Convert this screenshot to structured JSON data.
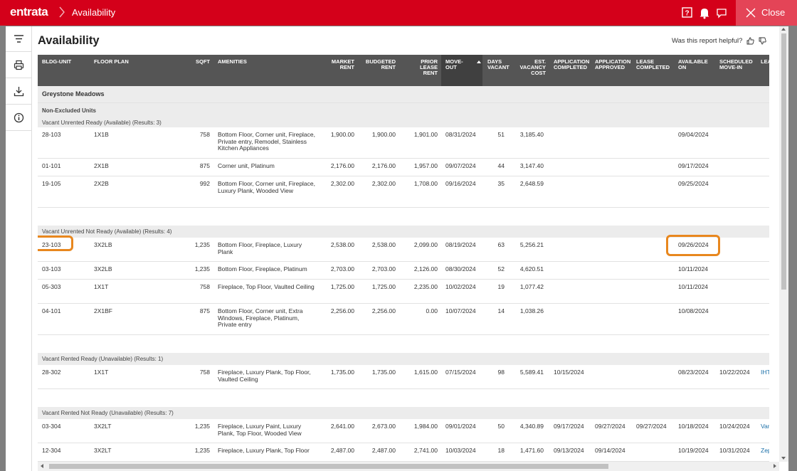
{
  "topbar": {
    "logo": "entrata",
    "breadcrumb": "Availability",
    "close_label": "Close",
    "color": "#d4001a"
  },
  "sidebar": {
    "icons": [
      "filter-icon",
      "print-icon",
      "download-icon",
      "info-icon"
    ]
  },
  "report": {
    "title": "Availability",
    "helpful_prompt": "Was this report helpful?"
  },
  "columns": {
    "bldg_unit": "BLDG-UNIT",
    "floor_plan": "FLOOR PLAN",
    "sqft": "SQFT",
    "amenities": "AMENITIES",
    "market_rent_1": "MARKET",
    "market_rent_2": "RENT",
    "budgeted_rent_1": "BUDGETED",
    "budgeted_rent_2": "RENT",
    "prior_lease_1": "PRIOR",
    "prior_lease_2": "LEASE",
    "prior_lease_3": "RENT",
    "move_out_1": "MOVE-",
    "move_out_2": "OUT",
    "days_vacant_1": "DAYS",
    "days_vacant_2": "VACANT",
    "vacancy_cost_1": "EST.",
    "vacancy_cost_2": "VACANCY",
    "vacancy_cost_3": "COST",
    "app_completed_1": "APPLICATION",
    "app_completed_2": "COMPLETED",
    "app_approved_1": "APPLICATION",
    "app_approved_2": "APPROVED",
    "lease_completed_1": "LEASE",
    "lease_completed_2": "COMPLETED",
    "available_on_1": "AVAILABLE",
    "available_on_2": "ON",
    "scheduled_1": "SCHEDULED",
    "scheduled_2": "MOVE-IN",
    "lead": "LEA"
  },
  "property": "Greystone Meadows",
  "non_excluded": "Non-Excluded Units",
  "groups": {
    "g1": "Vacant Unrented Ready (Available) (Results: 3)",
    "g2": "Vacant Unrented Not Ready (Available) (Results: 4)",
    "g3": "Vacant Rented Ready (Unavailable) (Results: 1)",
    "g4": "Vacant Rented Not Ready (Unavailable) (Results: 7)"
  },
  "rows": [
    {
      "unit": "28-103",
      "plan": "1X1B",
      "sqft": "758",
      "amenities": "Bottom Floor, Corner unit, Fireplace, Private entry, Remodel, Stainless Kitchen Appliances",
      "market": "1,900.00",
      "budgeted": "1,900.00",
      "prior": "1,901.00",
      "moveout": "08/31/2024",
      "days": "51",
      "cost": "3,185.40",
      "app_completed": "",
      "app_approved": "",
      "lease_completed": "",
      "available": "09/04/2024",
      "scheduled": "",
      "lead": ""
    },
    {
      "unit": "01-101",
      "plan": "2X1B",
      "sqft": "875",
      "amenities": "Corner unit, Platinum",
      "market": "2,176.00",
      "budgeted": "2,176.00",
      "prior": "1,957.00",
      "moveout": "09/07/2024",
      "days": "44",
      "cost": "3,147.40",
      "app_completed": "",
      "app_approved": "",
      "lease_completed": "",
      "available": "09/17/2024",
      "scheduled": "",
      "lead": ""
    },
    {
      "unit": "19-105",
      "plan": "2X2B",
      "sqft": "992",
      "amenities": "Bottom Floor, Corner unit, Fireplace, Luxury Plank, Wooded View",
      "market": "2,302.00",
      "budgeted": "2,302.00",
      "prior": "1,708.00",
      "moveout": "09/16/2024",
      "days": "35",
      "cost": "2,648.59",
      "app_completed": "",
      "app_approved": "",
      "lease_completed": "",
      "available": "09/25/2024",
      "scheduled": "",
      "lead": ""
    },
    {
      "unit": "23-103",
      "plan": "3X2LB",
      "sqft": "1,235",
      "amenities": "Bottom Floor, Fireplace, Luxury Plank",
      "market": "2,538.00",
      "budgeted": "2,538.00",
      "prior": "2,099.00",
      "moveout": "08/19/2024",
      "days": "63",
      "cost": "5,256.21",
      "app_completed": "",
      "app_approved": "",
      "lease_completed": "",
      "available": "09/26/2024",
      "scheduled": "",
      "lead": ""
    },
    {
      "unit": "03-103",
      "plan": "3X2LB",
      "sqft": "1,235",
      "amenities": "Bottom Floor, Fireplace, Platinum",
      "market": "2,703.00",
      "budgeted": "2,703.00",
      "prior": "2,126.00",
      "moveout": "08/30/2024",
      "days": "52",
      "cost": "4,620.51",
      "app_completed": "",
      "app_approved": "",
      "lease_completed": "",
      "available": "10/11/2024",
      "scheduled": "",
      "lead": ""
    },
    {
      "unit": "05-303",
      "plan": "1X1T",
      "sqft": "758",
      "amenities": "Fireplace, Top Floor, Vaulted Ceiling",
      "market": "1,725.00",
      "budgeted": "1,725.00",
      "prior": "2,235.00",
      "moveout": "10/02/2024",
      "days": "19",
      "cost": "1,077.42",
      "app_completed": "",
      "app_approved": "",
      "lease_completed": "",
      "available": "10/11/2024",
      "scheduled": "",
      "lead": ""
    },
    {
      "unit": "04-101",
      "plan": "2X1BF",
      "sqft": "875",
      "amenities": "Bottom Floor, Corner unit, Extra Windows, Fireplace, Platinum, Private entry",
      "market": "2,256.00",
      "budgeted": "2,256.00",
      "prior": "0.00",
      "moveout": "10/07/2024",
      "days": "14",
      "cost": "1,038.26",
      "app_completed": "",
      "app_approved": "",
      "lease_completed": "",
      "available": "10/08/2024",
      "scheduled": "",
      "lead": ""
    },
    {
      "unit": "28-302",
      "plan": "1X1T",
      "sqft": "758",
      "amenities": "Fireplace, Luxury Plank, Top Floor, Vaulted Ceiling",
      "market": "1,735.00",
      "budgeted": "1,735.00",
      "prior": "1,615.00",
      "moveout": "07/15/2024",
      "days": "98",
      "cost": "5,589.41",
      "app_completed": "10/15/2024",
      "app_approved": "",
      "lease_completed": "",
      "available": "08/23/2024",
      "scheduled": "10/22/2024",
      "lead": "IHT"
    },
    {
      "unit": "03-304",
      "plan": "3X2LT",
      "sqft": "1,235",
      "amenities": "Fireplace, Luxury Paint, Luxury Plank, Top Floor, Wooded View",
      "market": "2,641.00",
      "budgeted": "2,673.00",
      "prior": "1,984.00",
      "moveout": "09/01/2024",
      "days": "50",
      "cost": "4,340.89",
      "app_completed": "09/17/2024",
      "app_approved": "09/27/2024",
      "lease_completed": "09/27/2024",
      "available": "10/18/2024",
      "scheduled": "10/24/2024",
      "lead": "Var"
    },
    {
      "unit": "12-304",
      "plan": "3X2LT",
      "sqft": "1,235",
      "amenities": "Fireplace, Luxury Plank, Top Floor",
      "market": "2,487.00",
      "budgeted": "2,487.00",
      "prior": "2,741.00",
      "moveout": "10/03/2024",
      "days": "18",
      "cost": "1,471.60",
      "app_completed": "09/13/2024",
      "app_approved": "09/14/2024",
      "lease_completed": "",
      "available": "10/19/2024",
      "scheduled": "10/31/2024",
      "lead": "Zep"
    }
  ],
  "highlight_color": "#e8871e"
}
